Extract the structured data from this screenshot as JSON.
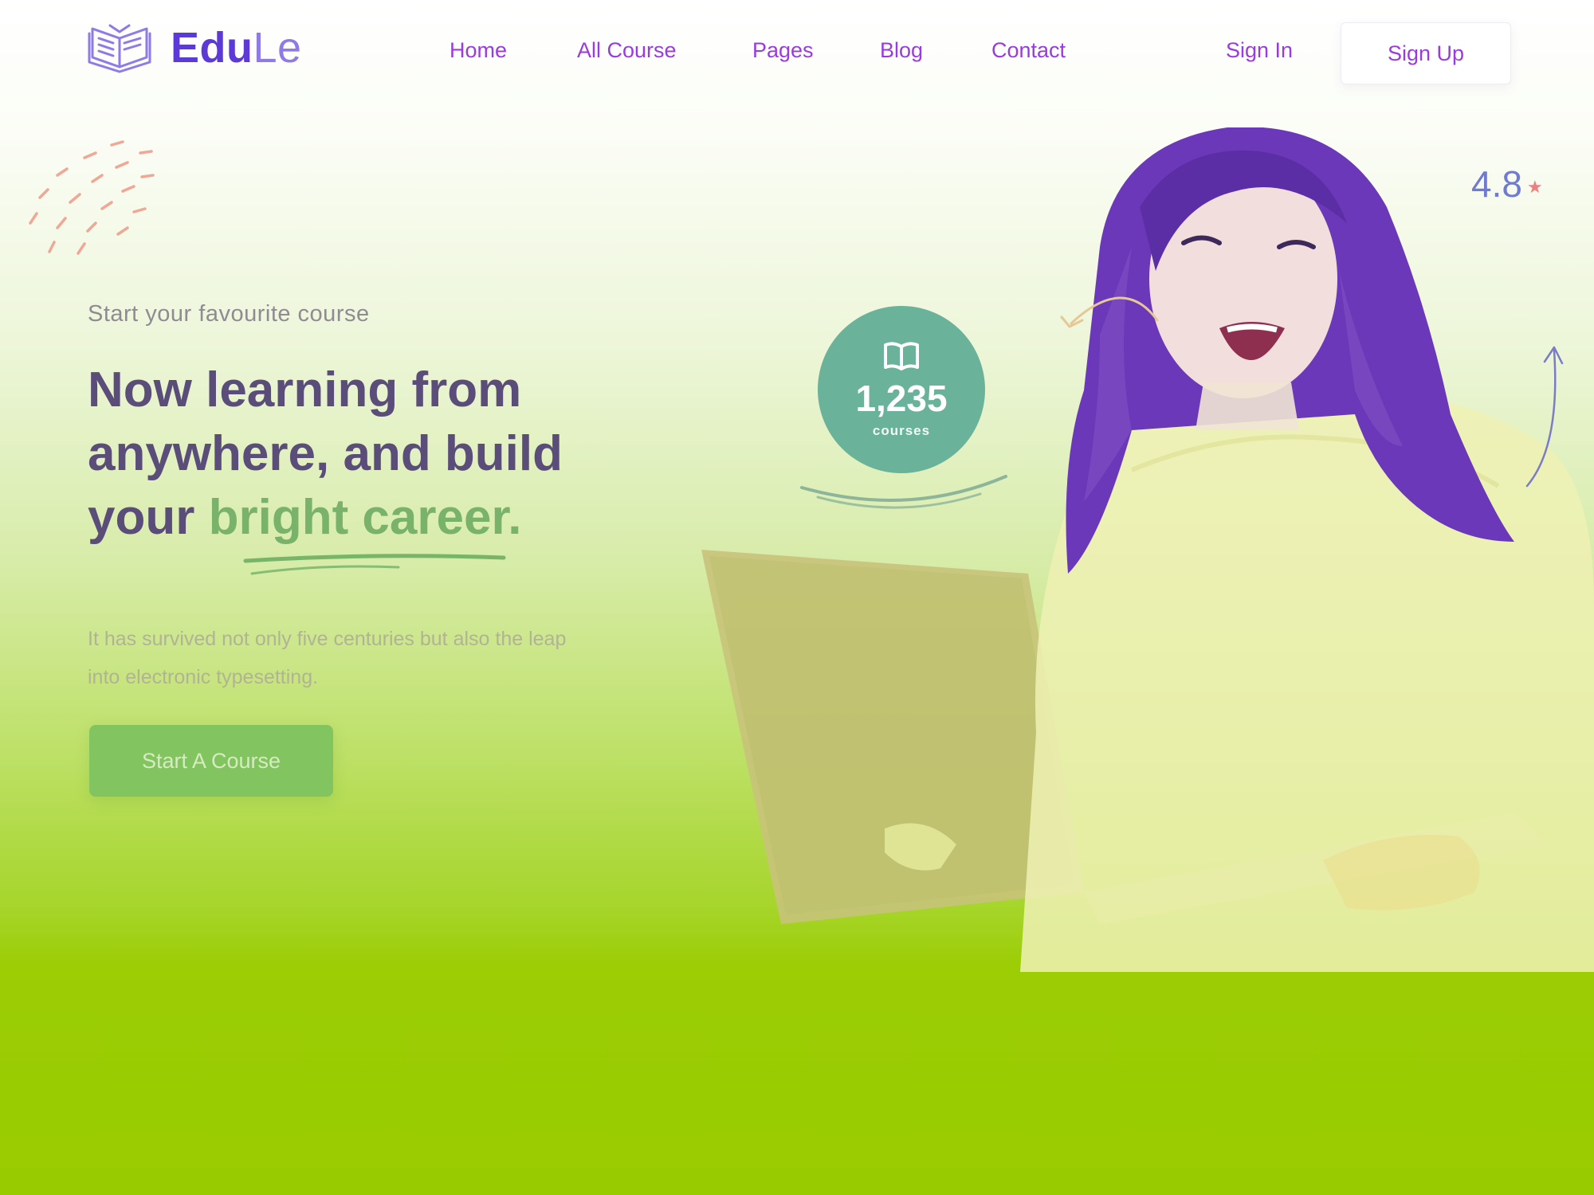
{
  "brand": {
    "part1": "Edu",
    "part2": "Le"
  },
  "nav": {
    "items": [
      "Home",
      "All Course",
      "Pages",
      "Blog",
      "Contact"
    ],
    "sign_in": "Sign In",
    "sign_up": "Sign Up"
  },
  "hero": {
    "eyebrow": "Start your favourite course",
    "headline_part1": "Now learning from anywhere, and build your ",
    "headline_highlight": "bright career.",
    "description": "It has survived not only five centuries but also the leap into electronic typesetting.",
    "cta": "Start A Course"
  },
  "stats": {
    "courses_count": "1,235",
    "courses_label": "courses",
    "rating": "4.8"
  },
  "colors": {
    "brand_primary": "#5b3ad6",
    "nav_text": "#9a3be0",
    "accent_green": "#79b26a",
    "badge_teal": "#6ab39a",
    "cta_green": "#82c45f"
  },
  "icons": {
    "logo": "open-book-logo-icon",
    "badge": "book-icon",
    "rating": "star-icon"
  }
}
